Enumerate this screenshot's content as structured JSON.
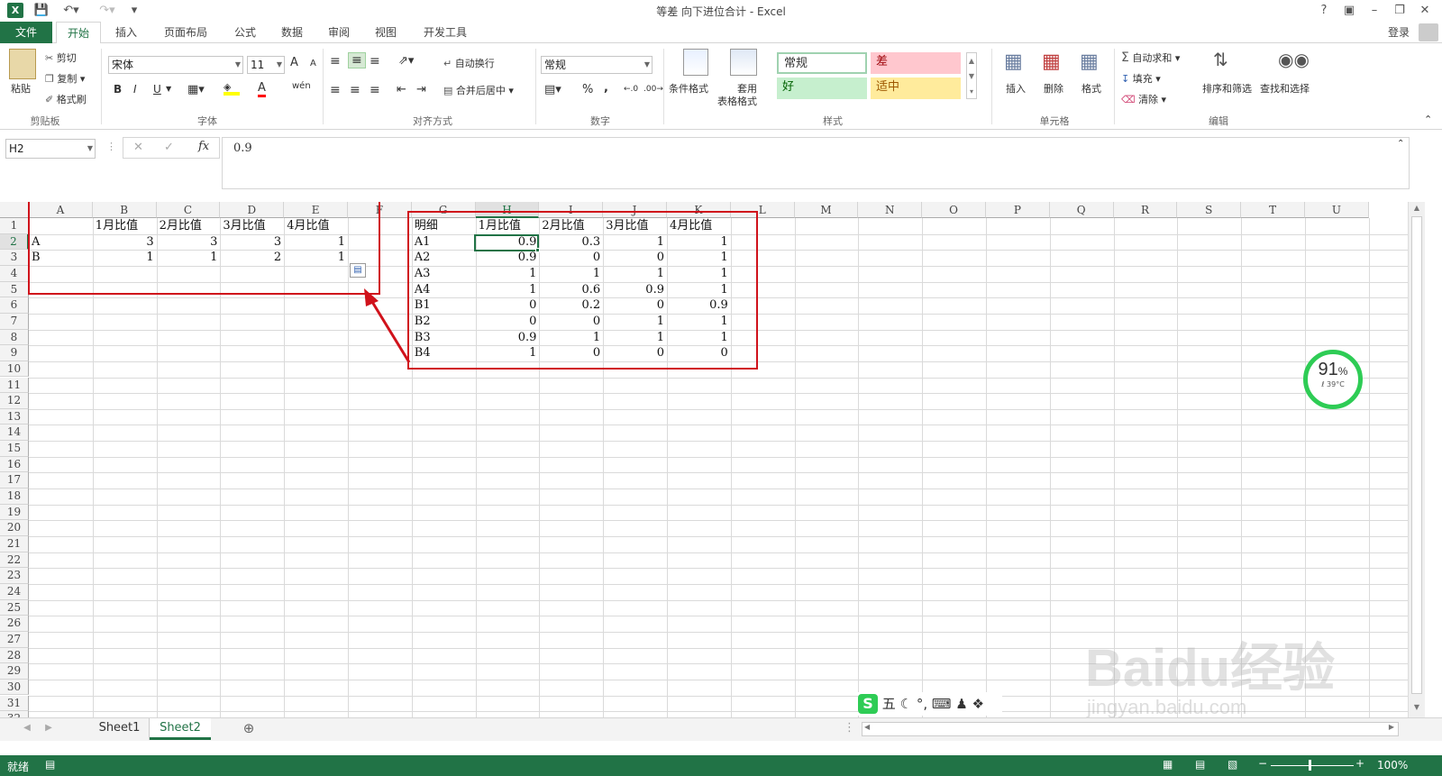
{
  "window": {
    "title": "等差 向下进位合计 - Excel",
    "help": "?",
    "signin": "登录"
  },
  "tabs": [
    "文件",
    "开始",
    "插入",
    "页面布局",
    "公式",
    "数据",
    "审阅",
    "视图",
    "开发工具"
  ],
  "ribbon": {
    "clipboard": {
      "paste": "粘贴",
      "cut": "剪切",
      "copy": "复制",
      "format_painter": "格式刷",
      "label": "剪贴板"
    },
    "font": {
      "name": "宋体",
      "size": "11",
      "bold": "B",
      "italic": "I",
      "underline": "U",
      "label": "字体",
      "grow": "A",
      "shrink": "A",
      "color_a": "A",
      "wen": "wén"
    },
    "alignment": {
      "wrap": "自动换行",
      "merge": "合并后居中",
      "label": "对齐方式"
    },
    "number": {
      "format": "常规",
      "percent": "%",
      "comma": ",",
      "label": "数字"
    },
    "styles": {
      "conditional": "条件格式",
      "table_format_1": "套用",
      "table_format_2": "表格格式",
      "normal": "常规",
      "bad": "差",
      "good": "好",
      "neutral": "适中",
      "label": "样式",
      "colors": {
        "bad_bg": "#ffc7ce",
        "bad_fg": "#9c0006",
        "good_bg": "#c6efce",
        "good_fg": "#006100",
        "neutral_bg": "#ffeb9c",
        "neutral_fg": "#9c5700"
      }
    },
    "cells": {
      "insert": "插入",
      "delete": "删除",
      "format": "格式",
      "label": "单元格"
    },
    "editing": {
      "autosum": "自动求和",
      "fill": "填充",
      "clear": "清除",
      "sort": "排序和筛选",
      "find": "查找和选择",
      "label": "编辑"
    }
  },
  "formula_bar": {
    "name_box": "H2",
    "fx": "fx",
    "value": "0.9"
  },
  "grid": {
    "columns": [
      "A",
      "B",
      "C",
      "D",
      "E",
      "F",
      "G",
      "H",
      "I",
      "J",
      "K",
      "L",
      "M",
      "N",
      "O",
      "P",
      "Q",
      "R",
      "S",
      "T",
      "U"
    ],
    "rows": [
      "1",
      "2",
      "3",
      "4",
      "5",
      "6",
      "7",
      "8",
      "9",
      "10",
      "11",
      "12",
      "13",
      "14",
      "15",
      "16",
      "17",
      "18",
      "19",
      "20",
      "21",
      "22",
      "23",
      "24",
      "25",
      "26",
      "27",
      "28",
      "29",
      "30",
      "31",
      "32"
    ],
    "summary_header": [
      "",
      "1月比值",
      "2月比值",
      "3月比值",
      "4月比值"
    ],
    "summary_rows": [
      [
        "A",
        "3",
        "3",
        "3",
        "1"
      ],
      [
        "B",
        "1",
        "1",
        "2",
        "1"
      ]
    ],
    "detail_header": [
      "明细",
      "1月比值",
      "2月比值",
      "3月比值",
      "4月比值"
    ],
    "detail_rows": [
      [
        "A1",
        "0.9",
        "0.3",
        "1",
        "1"
      ],
      [
        "A2",
        "0.9",
        "0",
        "0",
        "1"
      ],
      [
        "A3",
        "1",
        "1",
        "1",
        "1"
      ],
      [
        "A4",
        "1",
        "0.6",
        "0.9",
        "1"
      ],
      [
        "B1",
        "0",
        "0.2",
        "0",
        "0.9"
      ],
      [
        "B2",
        "0",
        "0",
        "1",
        "1"
      ],
      [
        "B3",
        "0.9",
        "1",
        "1",
        "1"
      ],
      [
        "B4",
        "1",
        "0",
        "0",
        "0"
      ]
    ],
    "annotation_color": "#d0121b"
  },
  "widget": {
    "percent": "91",
    "percent_sign": "%",
    "temp": "39°C"
  },
  "ime": {
    "label": "五"
  },
  "sheets": [
    "Sheet1",
    "Sheet2"
  ],
  "active_sheet": "Sheet2",
  "status": {
    "ready": "就绪",
    "zoom": "100%"
  },
  "watermark": {
    "brand": "Baidu经验",
    "url": "jingyan.baidu.com"
  }
}
